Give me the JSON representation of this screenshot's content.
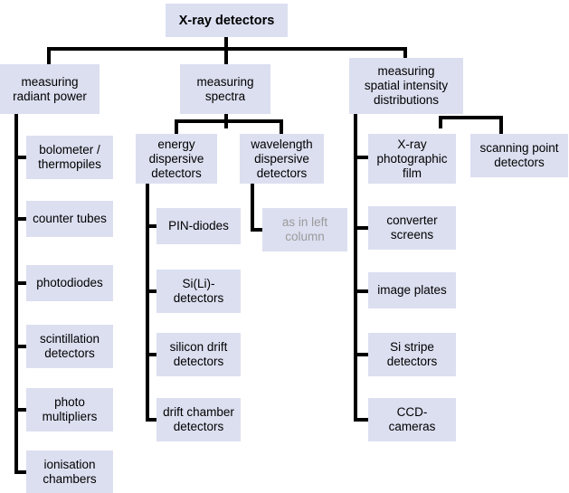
{
  "diagram": {
    "title": "X-ray detectors",
    "type": "tree-hierarchy",
    "branches": [
      {
        "label": "measuring\nradiant power",
        "children": [
          "bolometer /\nthermopiles",
          "counter tubes",
          "photodiodes",
          "scintillation\ndetectors",
          "photo\nmultipliers",
          "ionisation\nchambers"
        ]
      },
      {
        "label": "measuring\nspectra",
        "subbranches": [
          {
            "label": "energy\ndispersive\ndetectors",
            "children": [
              "PIN-diodes",
              "Si(Li)-\ndetectors",
              "silicon drift\ndetectors",
              "drift chamber\ndetectors"
            ]
          },
          {
            "label": "wavelength\ndispersive\ndetectors",
            "children": [
              "as in left\ncolumn"
            ]
          }
        ]
      },
      {
        "label": "measuring\nspatial intensity\ndistributions",
        "children": [
          "X-ray\nphotographic\nfilm",
          "converter\nscreens",
          "image plates",
          "Si stripe\ndetectors",
          "CCD-\ncameras"
        ],
        "side_children": [
          "scanning point\ndetectors"
        ]
      }
    ],
    "colors": {
      "node_fill": "#dcdff0",
      "node_text": "#000000",
      "muted_text": "#9b9b9b",
      "connector": "#000000",
      "background": "#ffffff"
    }
  }
}
